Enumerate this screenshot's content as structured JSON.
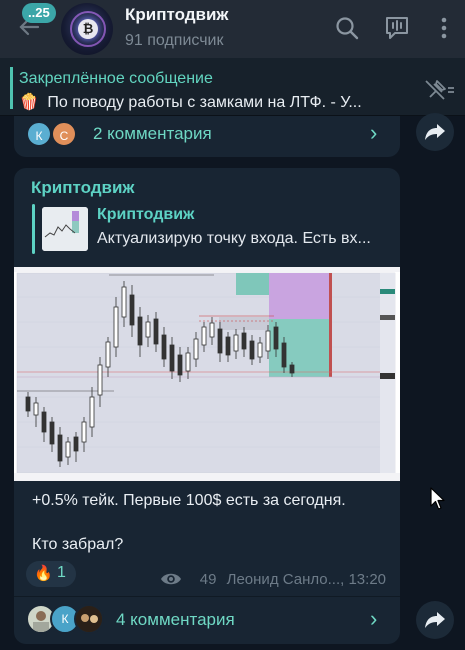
{
  "header": {
    "unread_count": "..25",
    "title": "Криптодвиж",
    "subscribers": "91 подписчик",
    "icons": [
      "back-arrow-icon",
      "search-icon",
      "poll-icon",
      "more-icon"
    ]
  },
  "pinned": {
    "title": "Закреплённое сообщение",
    "emoji": "🍿",
    "text": "По поводу работы с замками на ЛТФ.  - У..."
  },
  "prev_post": {
    "avatars": [
      "К",
      "С"
    ],
    "comments_label": "2 комментария"
  },
  "post": {
    "author": "Криптодвиж",
    "reply": {
      "name": "Криптодвиж",
      "text": "Актуализирую точку входа. Есть вх..."
    },
    "text_line1": "+0.5% тейк. Первые 100$ есть за сегодня.",
    "text_line2": "Кто забрал?",
    "reaction_emoji": "🔥",
    "reaction_count": "1",
    "views": "49",
    "signature_time": "Леонид Санло..., 13:20",
    "comment_avatars": [
      "К"
    ],
    "comments_label": "4 комментария"
  },
  "colors": {
    "background": "#0e1621",
    "bubble": "#182533",
    "accent": "#5dd2c4",
    "header": "#232b36"
  }
}
